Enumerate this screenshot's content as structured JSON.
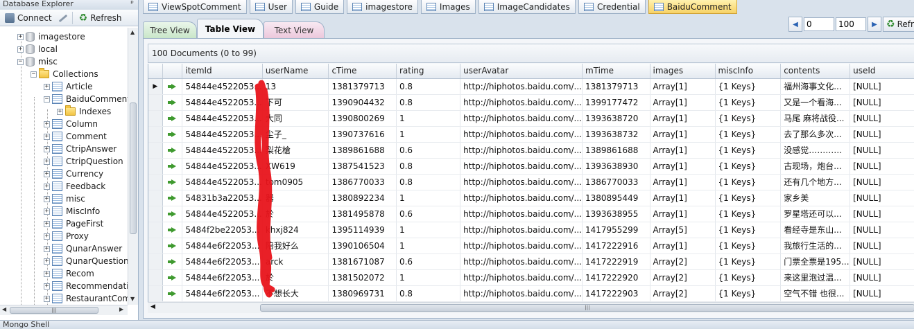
{
  "left_panel": {
    "title": "Database Explorer",
    "pin": "ᵖ",
    "connect_label": "Connect",
    "refresh_label": "Refresh",
    "tree": [
      {
        "label": "imagestore",
        "type": "db",
        "level": 0,
        "exp": "+"
      },
      {
        "label": "local",
        "type": "db",
        "level": 0,
        "exp": "+"
      },
      {
        "label": "misc",
        "type": "db",
        "level": 0,
        "exp": "−"
      },
      {
        "label": "Collections",
        "type": "folder",
        "level": 1,
        "exp": "−"
      },
      {
        "label": "Article",
        "type": "coll",
        "level": 2,
        "exp": "+"
      },
      {
        "label": "BaiduComment",
        "type": "coll",
        "level": 2,
        "exp": "−"
      },
      {
        "label": "Indexes",
        "type": "folder",
        "level": 3,
        "exp": "+"
      },
      {
        "label": "Column",
        "type": "coll",
        "level": 2,
        "exp": "+"
      },
      {
        "label": "Comment",
        "type": "coll",
        "level": 2,
        "exp": "+"
      },
      {
        "label": "CtripAnswer",
        "type": "coll",
        "level": 2,
        "exp": "+"
      },
      {
        "label": "CtripQuestion",
        "type": "coll",
        "level": 2,
        "exp": "+"
      },
      {
        "label": "Currency",
        "type": "coll",
        "level": 2,
        "exp": "+"
      },
      {
        "label": "Feedback",
        "type": "coll",
        "level": 2,
        "exp": "+"
      },
      {
        "label": "misc",
        "type": "coll",
        "level": 2,
        "exp": "+"
      },
      {
        "label": "MiscInfo",
        "type": "coll",
        "level": 2,
        "exp": "+"
      },
      {
        "label": "PageFirst",
        "type": "coll",
        "level": 2,
        "exp": "+"
      },
      {
        "label": "Proxy",
        "type": "coll",
        "level": 2,
        "exp": "+"
      },
      {
        "label": "QunarAnswer",
        "type": "coll",
        "level": 2,
        "exp": "+"
      },
      {
        "label": "QunarQuestion",
        "type": "coll",
        "level": 2,
        "exp": "+"
      },
      {
        "label": "Recom",
        "type": "coll",
        "level": 2,
        "exp": "+"
      },
      {
        "label": "Recommendati",
        "type": "coll",
        "level": 2,
        "exp": "+"
      },
      {
        "label": "RestaurantCom",
        "type": "coll",
        "level": 2,
        "exp": "+"
      }
    ],
    "bottom_label": "Mongo Shell"
  },
  "doc_tabs": [
    {
      "label": "ViewSpotComment",
      "active": false
    },
    {
      "label": "User",
      "active": false
    },
    {
      "label": "Guide",
      "active": false
    },
    {
      "label": "imagestore",
      "active": false
    },
    {
      "label": "Images",
      "active": false
    },
    {
      "label": "ImageCandidates",
      "active": false
    },
    {
      "label": "Credential",
      "active": false
    },
    {
      "label": "BaiduComment",
      "active": true
    }
  ],
  "view_tabs": {
    "tree": "Tree View",
    "table": "Table View",
    "text": "Text View"
  },
  "pager": {
    "skip": "0",
    "limit": "100",
    "refresh_label": "Refresh"
  },
  "doc_count": "100 Documents (0 to 99)",
  "table": {
    "columns": [
      "itemId",
      "userName",
      "cTime",
      "rating",
      "userAvatar",
      "mTime",
      "images",
      "miscInfo",
      "contents",
      "useId"
    ],
    "rows": [
      [
        "54844e4522053...",
        "13",
        "1381379713",
        "0.8",
        "http://hiphotos.baidu.com/...",
        "1381379713",
        "Array[1]",
        "{1 Keys}",
        "福州海事文化...",
        "[NULL]"
      ],
      [
        "54844e4522053...",
        "下可",
        "1390904432",
        "0.8",
        "http://hiphotos.baidu.com/...",
        "1399177472",
        "Array[1]",
        "{1 Keys}",
        "又是一个看海...",
        "[NULL]"
      ],
      [
        "54844e4522053...",
        "大同",
        "1390800269",
        "1",
        "http://hiphotos.baidu.com/...",
        "1393638720",
        "Array[1]",
        "{1 Keys}",
        "马尾 麻将战役...",
        "[NULL]"
      ],
      [
        "54844e4522053...",
        "尘子_",
        "1390737616",
        "1",
        "http://hiphotos.baidu.com/...",
        "1393638732",
        "Array[1]",
        "{1 Keys}",
        "去了那么多次...",
        "[NULL]"
      ],
      [
        "54844e4522053...",
        "梨花槍",
        "1389861688",
        "0.6",
        "http://hiphotos.baidu.com/...",
        "1389861688",
        "Array[1]",
        "{1 Keys}",
        "没感觉…………",
        "[NULL]"
      ],
      [
        "54844e4522053...",
        "XW619",
        "1387541523",
        "0.8",
        "http://hiphotos.baidu.com/...",
        "1393638930",
        "Array[1]",
        "{1 Keys}",
        "古现场，炮台...",
        "[NULL]"
      ],
      [
        "54844e4522053...",
        "tom0905",
        "1386770033",
        "0.8",
        "http://hiphotos.baidu.com/...",
        "1386770033",
        "Array[1]",
        "{1 Keys}",
        "还有几个地方...",
        "[NULL]"
      ],
      [
        "54831b3a22053...",
        "器",
        "1380892234",
        "1",
        "http://hiphotos.baidu.com/...",
        "1380895449",
        "Array[1]",
        "{1 Keys}",
        "家乡美",
        "[NULL]"
      ],
      [
        "54844e4522053...",
        "於",
        "1381495878",
        "0.6",
        "http://hiphotos.baidu.com/...",
        "1393638955",
        "Array[1]",
        "{1 Keys}",
        "罗星塔还可以...",
        "[NULL]"
      ],
      [
        "5484f2be22053...",
        "khxj824",
        "1395114939",
        "1",
        "http://hiphotos.baidu.com/...",
        "1417955299",
        "Array[5]",
        "{1 Keys}",
        "看经寺是东山...",
        "[NULL]"
      ],
      [
        "54844e6f22053...",
        "陪我好么",
        "1390106504",
        "1",
        "http://hiphotos.baidu.com/...",
        "1417222916",
        "Array[1]",
        "{1 Keys}",
        "我旅行生活的...",
        "[NULL]"
      ],
      [
        "54844e6f22053...",
        "arck",
        "1381671087",
        "0.6",
        "http://hiphotos.baidu.com/...",
        "1417222919",
        "Array[2]",
        "{1 Keys}",
        "门票全票是195...",
        "[NULL]"
      ],
      [
        "54844e6f22053...",
        "於",
        "1381502072",
        "1",
        "http://hiphotos.baidu.com/...",
        "1417222920",
        "Array[2]",
        "{1 Keys}",
        "来这里泡过温...",
        "[NULL]"
      ],
      [
        "54844e6f22053...",
        "不想长大",
        "1380969731",
        "0.8",
        "http://hiphotos.baidu.com/...",
        "1417222903",
        "Array[2]",
        "{1 Keys}",
        "空气不错 也很...",
        "[NULL]"
      ]
    ]
  },
  "colors": {
    "accent_tab": "#f7d266",
    "row_arrow": "#3f9a2f",
    "scribble": "#e8141b"
  },
  "icons": {
    "connect": "connect-icon",
    "disconnect": "disconnect-icon",
    "refresh": "refresh-icon",
    "database": "database-icon",
    "folder": "folder-icon",
    "collection": "collection-icon",
    "row_arrow": "row-arrow-icon"
  }
}
